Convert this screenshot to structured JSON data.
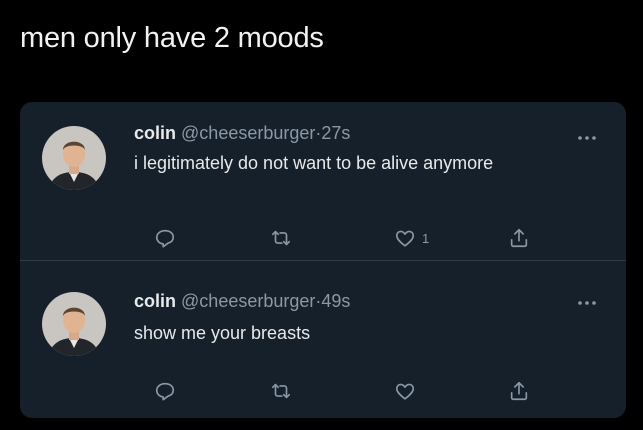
{
  "caption": "men only have 2 moods",
  "colors": {
    "page_bg": "#000000",
    "card_bg": "#15202b",
    "text": "#e7e9ea",
    "muted": "#8b98a5"
  },
  "tweets": [
    {
      "name": "colin",
      "handle": "@cheeserburger",
      "dot": "·",
      "time": "27s",
      "text": "i legitimately do not want to be alive anymore",
      "like_count": "1",
      "icons": [
        "reply-icon",
        "retweet-icon",
        "like-icon",
        "share-icon",
        "more-icon"
      ]
    },
    {
      "name": "colin",
      "handle": "@cheeserburger",
      "dot": "·",
      "time": "49s",
      "text": "show me your breasts",
      "like_count": "",
      "icons": [
        "reply-icon",
        "retweet-icon",
        "like-icon",
        "share-icon",
        "more-icon"
      ]
    }
  ]
}
